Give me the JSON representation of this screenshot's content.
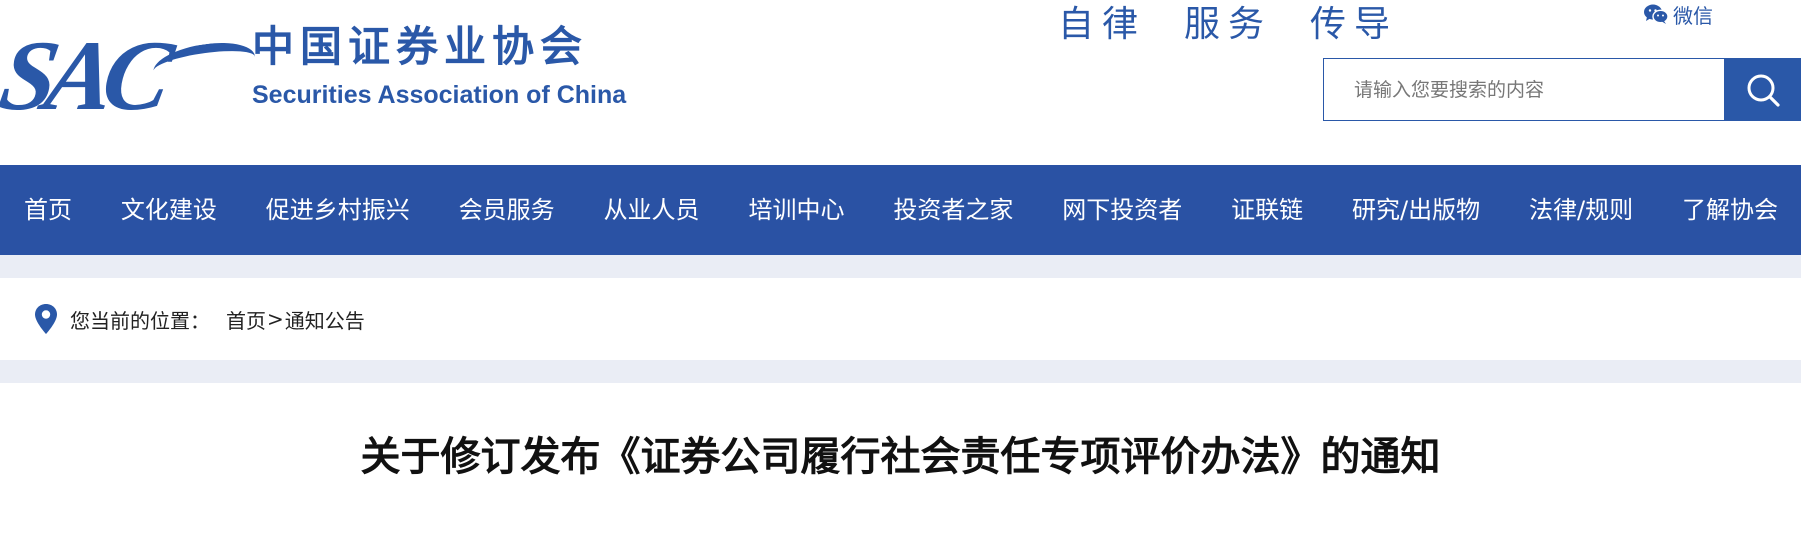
{
  "header": {
    "logo": {
      "mark": "SAC",
      "name_cn": "中国证券业协会",
      "name_en": "Securities Association of China"
    },
    "slogan": [
      "自律",
      "服务",
      "传导"
    ],
    "wechat_label": "微信",
    "search": {
      "placeholder": "请输入您要搜索的内容",
      "value": ""
    }
  },
  "nav": {
    "items": [
      {
        "label": "首页"
      },
      {
        "label": "文化建设"
      },
      {
        "label": "促进乡村振兴"
      },
      {
        "label": "会员服务"
      },
      {
        "label": "从业人员"
      },
      {
        "label": "培训中心"
      },
      {
        "label": "投资者之家"
      },
      {
        "label": "网下投资者"
      },
      {
        "label": "证联链"
      },
      {
        "label": "研究/出版物"
      },
      {
        "label": "法律/规则"
      },
      {
        "label": "了解协会"
      }
    ]
  },
  "breadcrumb": {
    "label": "您当前的位置：",
    "home": "首页",
    "separator": ">",
    "current": "通知公告"
  },
  "article": {
    "title": "关于修订发布《证券公司履行社会责任专项评价办法》的通知"
  },
  "colors": {
    "brand": "#2a58a8",
    "nav_bg": "#2a52a4",
    "band_bg": "#eaedf5"
  },
  "icons": [
    "search-icon",
    "wechat-icon",
    "location-pin-icon"
  ]
}
